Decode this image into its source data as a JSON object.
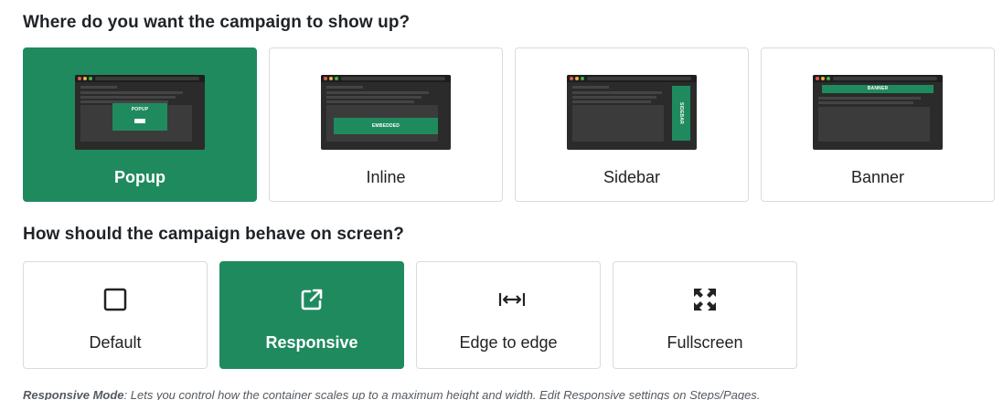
{
  "placement": {
    "heading": "Where do you want the campaign to show up?",
    "options": [
      {
        "label": "Popup",
        "preview_text": "POPUP",
        "selected": true
      },
      {
        "label": "Inline",
        "preview_text": "EMBEDDED",
        "selected": false
      },
      {
        "label": "Sidebar",
        "preview_text": "SIDEBAR",
        "selected": false
      },
      {
        "label": "Banner",
        "preview_text": "BANNER",
        "selected": false
      }
    ]
  },
  "behavior": {
    "heading": "How should the campaign behave on screen?",
    "options": [
      {
        "label": "Default",
        "icon": "square-outline-icon",
        "selected": false
      },
      {
        "label": "Responsive",
        "icon": "external-link-icon",
        "selected": true
      },
      {
        "label": "Edge to edge",
        "icon": "horizontal-expand-icon",
        "selected": false
      },
      {
        "label": "Fullscreen",
        "icon": "fullscreen-arrows-icon",
        "selected": false
      }
    ]
  },
  "note": {
    "title": "Responsive Mode",
    "text": ": Lets you control how the container scales up to a maximum height and width. Edit Responsive settings on Steps/Pages."
  },
  "colors": {
    "accent": "#208a5f",
    "border": "#d9dbde",
    "preview_dark": "#2b2b2b"
  }
}
